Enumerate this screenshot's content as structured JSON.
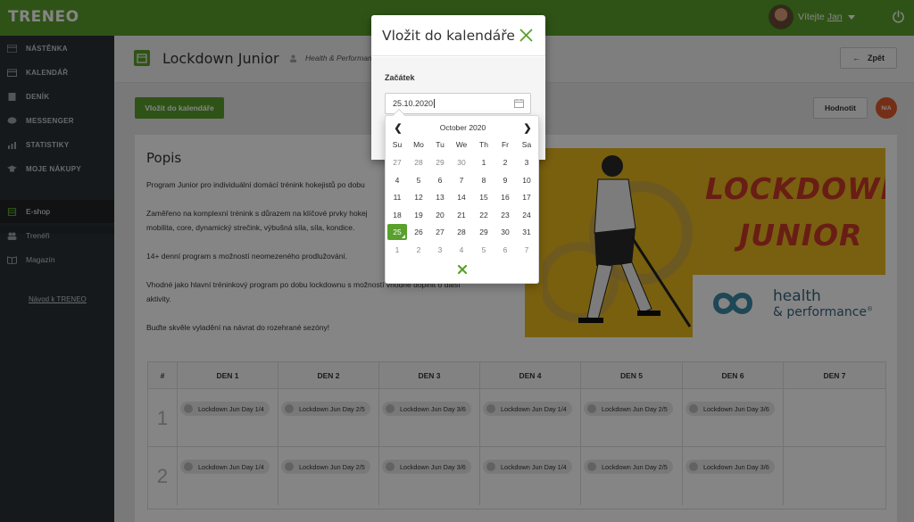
{
  "topbar": {
    "logo": "TRENEO",
    "welcome": "Vítejte",
    "user_name": "Jan"
  },
  "sidebar": {
    "items": [
      {
        "label": "NÁSTĚNKA",
        "icon": "dashboard-icon"
      },
      {
        "label": "KALENDÁŘ",
        "icon": "calendar-icon"
      },
      {
        "label": "DENÍK",
        "icon": "book-icon"
      },
      {
        "label": "MESSENGER",
        "icon": "chat-icon"
      },
      {
        "label": "STATISTIKY",
        "icon": "chart-icon"
      },
      {
        "label": "MOJE NÁKUPY",
        "icon": "graduation-cap-icon"
      }
    ],
    "secondary": [
      {
        "label": "E-shop",
        "icon": "cart-icon"
      },
      {
        "label": "Trenéři",
        "icon": "users-icon"
      },
      {
        "label": "Magazín",
        "icon": "open-book-icon"
      }
    ],
    "link": "Návod k TRENEO"
  },
  "page": {
    "title": "Lockdown Junior",
    "category": "Health & Performance",
    "back_label": "Zpět",
    "add_calendar_label": "Vložit do kalendáře",
    "rate_label": "Hodnotit",
    "rating_badge": "N/A"
  },
  "description": {
    "title": "Popis",
    "p1": "Program Junior pro individuální domácí trénink hokejistů po dobu",
    "p2a": "Zaměřeno na komplexní trénink s důrazem na klíčové prvky hokej",
    "p2b": "mobilita, core, dynamický strečink, výbušná síla, síla, kondice.",
    "p3": "14+ denní program s možností neomezeného prodlužování.",
    "p4a": "Vhodné jako hlavní tréninkový program po dobu lockdownu s možností vhodně doplnit o další",
    "p4b": "aktivity.",
    "p5": "Buďte skvěle vyladění na návrat do rozehrané sezóny!"
  },
  "promo": {
    "line1": "LOCKDOWN",
    "line2": "JUNIOR",
    "brand1": "health",
    "brand2": "& performance",
    "brand_mark": "®"
  },
  "schedule": {
    "hash": "#",
    "days": [
      "DEN 1",
      "DEN 2",
      "DEN 3",
      "DEN 4",
      "DEN 5",
      "DEN 6",
      "DEN 7"
    ],
    "rows": [
      {
        "num": "1",
        "cells": [
          "Lockdown Jun Day 1/4",
          "Lockdown Jun Day 2/5",
          "Lockdown Jun Day 3/6",
          "Lockdown Jun Day 1/4",
          "Lockdown Jun Day 2/5",
          "Lockdown Jun Day 3/6",
          ""
        ]
      },
      {
        "num": "2",
        "cells": [
          "Lockdown Jun Day 1/4",
          "Lockdown Jun Day 2/5",
          "Lockdown Jun Day 3/6",
          "Lockdown Jun Day 1/4",
          "Lockdown Jun Day 2/5",
          "Lockdown Jun Day 3/6",
          ""
        ]
      }
    ]
  },
  "modal": {
    "title": "Vložit do kalendáře",
    "field_label": "Začátek",
    "date_value": "25.10.2020"
  },
  "datepicker": {
    "month": "October 2020",
    "weekdays": [
      "Su",
      "Mo",
      "Tu",
      "We",
      "Th",
      "Fr",
      "Sa"
    ],
    "weeks": [
      [
        "27",
        "28",
        "29",
        "30",
        "1",
        "2",
        "3"
      ],
      [
        "4",
        "5",
        "6",
        "7",
        "8",
        "9",
        "10"
      ],
      [
        "11",
        "12",
        "13",
        "14",
        "15",
        "16",
        "17"
      ],
      [
        "18",
        "19",
        "20",
        "21",
        "22",
        "23",
        "24"
      ],
      [
        "25",
        "26",
        "27",
        "28",
        "29",
        "30",
        "31"
      ],
      [
        "1",
        "2",
        "3",
        "4",
        "5",
        "6",
        "7"
      ]
    ],
    "selected": "25"
  },
  "colors": {
    "brand_green": "#5aa02c",
    "sidebar": "#2b3035",
    "promo_yellow": "#e9b81e",
    "promo_red": "#c93a2a",
    "badge_orange": "#e05a2b"
  }
}
